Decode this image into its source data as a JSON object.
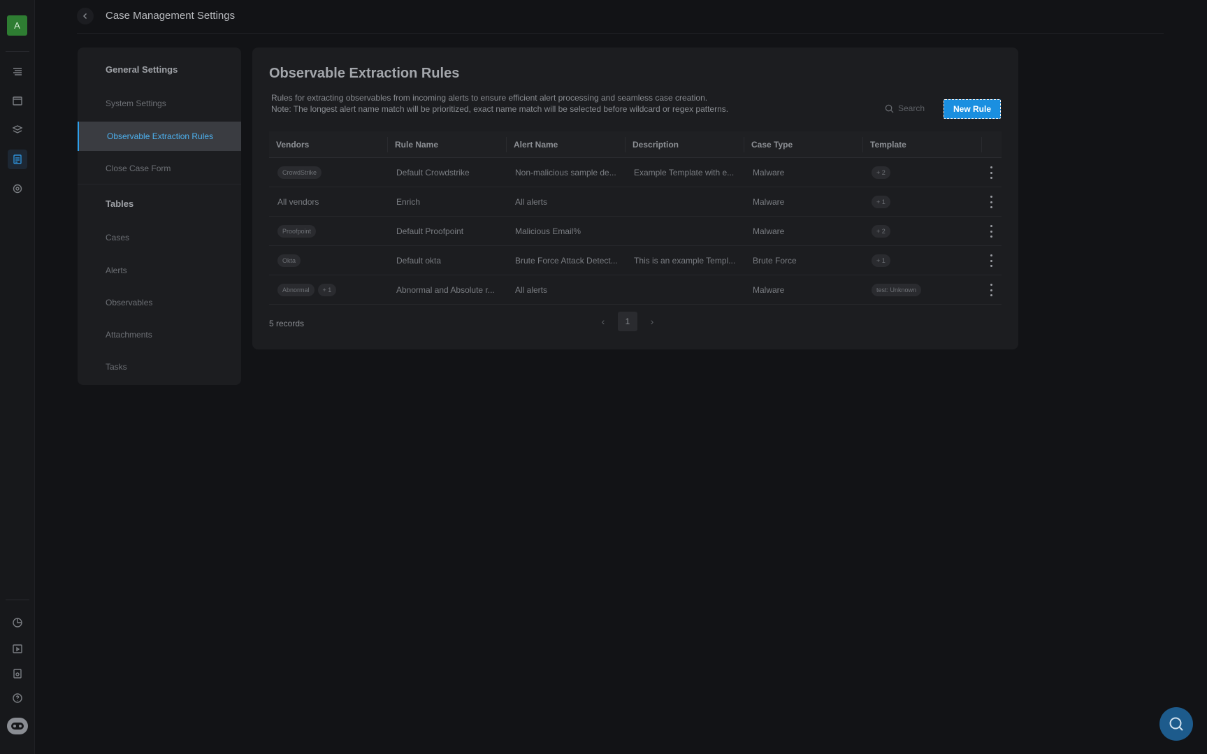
{
  "app": {
    "avatar_letter": "A",
    "accent": "#1a8fe0"
  },
  "header": {
    "title": "Case Management Settings"
  },
  "settings_nav": {
    "general_section": "General Settings",
    "items": [
      {
        "label": "System Settings"
      },
      {
        "label": "Observable Extraction Rules",
        "active": true
      },
      {
        "label": "Close Case Form"
      }
    ],
    "tables_section": "Tables",
    "table_items": [
      {
        "label": "Cases"
      },
      {
        "label": "Alerts"
      },
      {
        "label": "Observables"
      },
      {
        "label": "Attachments"
      },
      {
        "label": "Tasks"
      }
    ]
  },
  "main": {
    "title": "Observable Extraction Rules",
    "desc_line1": "Rules for extracting observables from incoming alerts to ensure efficient alert processing and seamless case creation.",
    "desc_line2": "Note: The longest alert name match will be prioritized, exact name match will be selected before wildcard or regex patterns.",
    "search_placeholder": "Search",
    "new_rule_label": "New Rule",
    "columns": [
      "Vendors",
      "Rule Name",
      "Alert Name",
      "Description",
      "Case Type",
      "Template"
    ],
    "rows": [
      {
        "vendor_tag": "CrowdStrike",
        "vendor_extra": "",
        "vendor_text": "",
        "rule_name": "Default Crowdstrike",
        "alert_name": "Non-malicious sample de...",
        "description": "Example Template with e...",
        "case_type": "Malware",
        "template": "+ 2"
      },
      {
        "vendor_tag": "",
        "vendor_extra": "",
        "vendor_text": "All vendors",
        "rule_name": "Enrich",
        "alert_name": "All alerts",
        "description": "",
        "case_type": "Malware",
        "template": "+ 1"
      },
      {
        "vendor_tag": "Proofpoint",
        "vendor_extra": "",
        "vendor_text": "",
        "rule_name": "Default Proofpoint",
        "alert_name": "Malicious Email%",
        "description": "",
        "case_type": "Malware",
        "template": "+ 2"
      },
      {
        "vendor_tag": "Okta",
        "vendor_extra": "",
        "vendor_text": "",
        "rule_name": "Default okta",
        "alert_name": "Brute Force Attack Detect...",
        "description": "This is an example Templ...",
        "case_type": "Brute Force",
        "template": "+ 1"
      },
      {
        "vendor_tag": "Abnormal",
        "vendor_extra": "+ 1",
        "vendor_text": "",
        "rule_name": "Abnormal and Absolute r...",
        "alert_name": "All alerts",
        "description": "",
        "case_type": "Malware",
        "template": "test: Unknown"
      }
    ],
    "records_label": "5 records",
    "current_page": "1"
  }
}
